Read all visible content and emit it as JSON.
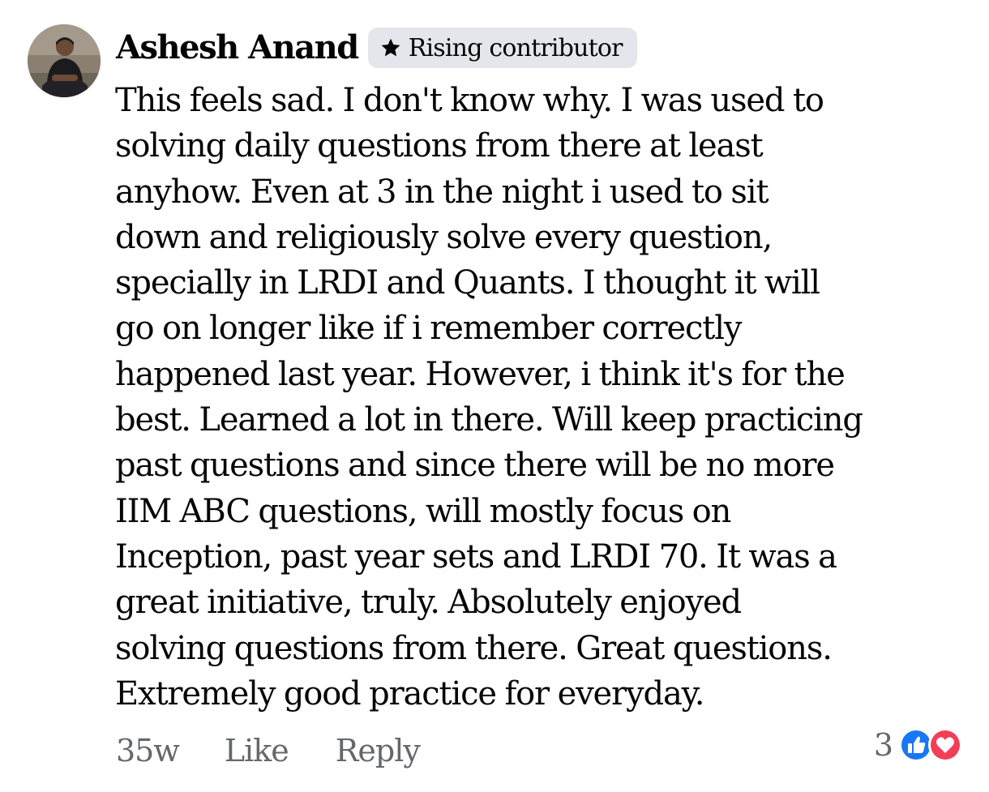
{
  "comment": {
    "author": "Ashesh Anand",
    "badge": {
      "icon": "star-icon",
      "label": "Rising contributor"
    },
    "body_lines": [
      "This feels sad. I don't know why. I was used to",
      "solving daily questions from there at least",
      "anyhow. Even at 3 in the night i used to sit",
      "down and religiously solve every question,",
      "specially in LRDI and Quants. I thought it will",
      "go on longer like if i remember correctly",
      "happened last year. However, i think it's for the",
      "best. Learned a lot in there. Will keep practicing",
      "past questions and since there will be no more",
      "IIM ABC questions, will mostly focus on",
      "Inception, past year sets and LRDI 70. It was a",
      "great initiative, truly. Absolutely enjoyed",
      "solving questions from there. Great questions.",
      "Extremely good practice for everyday."
    ],
    "timestamp": "35w",
    "like_label": "Like",
    "reply_label": "Reply",
    "reactions": {
      "count": "3",
      "icons": [
        "like-reaction-icon",
        "love-reaction-icon"
      ]
    }
  },
  "colors": {
    "text_primary": "#050505",
    "text_secondary": "#65676b",
    "badge_bg": "#e4e6eb",
    "like_blue": "#1877f2",
    "love_red": "#f33e58"
  }
}
